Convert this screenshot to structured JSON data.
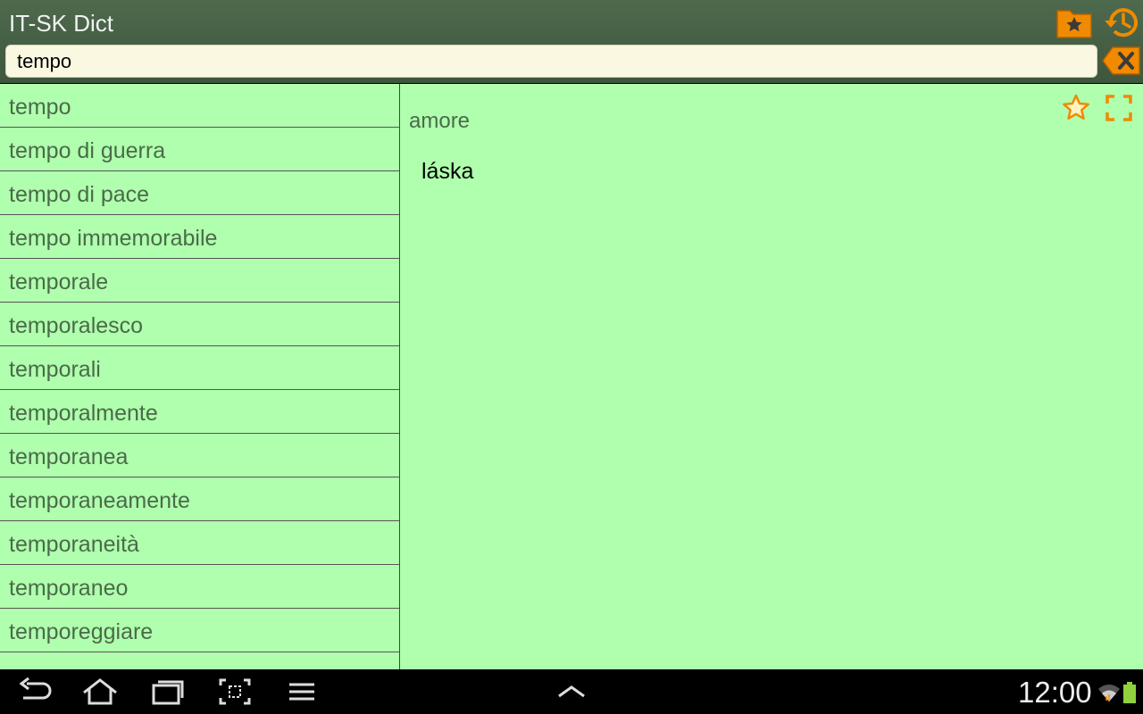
{
  "app": {
    "title": "IT-SK Dict"
  },
  "search": {
    "value": "tempo"
  },
  "word_list": [
    "tempo",
    "tempo di guerra",
    "tempo di pace",
    "tempo immemorabile",
    "temporale",
    "temporalesco",
    "temporali",
    "temporalmente",
    "temporanea",
    "temporaneamente",
    "temporaneità",
    "temporaneo",
    "temporeggiare"
  ],
  "detail": {
    "word": "amore",
    "translation": "láska"
  },
  "status": {
    "time": "12:00"
  },
  "icons": {
    "favorites": "favorites-folder-icon",
    "history": "history-icon",
    "clear": "clear-backspace-icon",
    "star": "star-icon",
    "expand": "fullscreen-icon"
  },
  "colors": {
    "accent": "#f08a00",
    "list_background": "#b0ffae",
    "list_text": "#4a6b49",
    "header": "#4e6a4d",
    "search_background": "#fbf8e1"
  }
}
